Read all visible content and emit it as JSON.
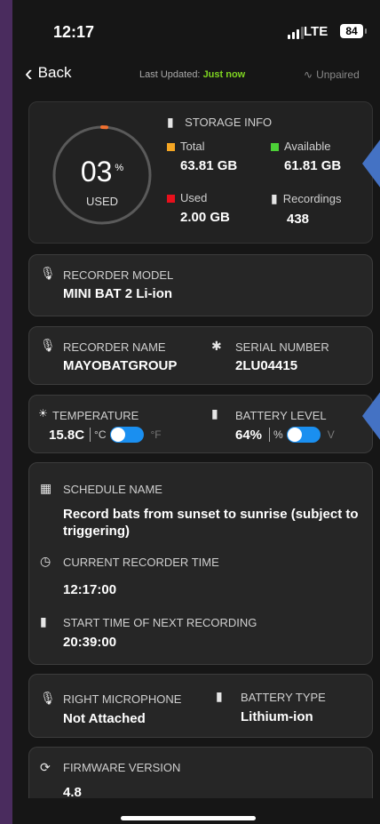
{
  "status_bar": {
    "time": "12:17",
    "network": "LTE",
    "battery": "84"
  },
  "nav": {
    "back_label": "Back",
    "last_updated_label": "Last Updated:",
    "last_updated_value": "Just now",
    "pair_status": "Unpaired"
  },
  "storage": {
    "title": "STORAGE INFO",
    "used_percent": "03",
    "percent_sign": "%",
    "used_caption": "USED",
    "used_fraction": 0.03,
    "total_label": "Total",
    "total_value": "63.81 GB",
    "available_label": "Available",
    "available_value": "61.81 GB",
    "used_label": "Used",
    "used_value": "2.00 GB",
    "recordings_label": "Recordings",
    "recordings_value": "438"
  },
  "recorder_model": {
    "label": "RECORDER MODEL",
    "value": "MINI BAT 2 Li-ion"
  },
  "recorder_name": {
    "label": "RECORDER NAME",
    "value": "MAYOBATGROUP"
  },
  "serial_number": {
    "label": "SERIAL NUMBER",
    "value": "2LU04415"
  },
  "temperature": {
    "label": "TEMPERATURE",
    "value": "15.8C",
    "unit_a": "°C",
    "unit_b": "°F"
  },
  "battery_level": {
    "label": "BATTERY LEVEL",
    "value": "64%",
    "unit_a": "%",
    "unit_b": "V"
  },
  "schedule": {
    "schedule_label": "SCHEDULE NAME",
    "schedule_value": "Record bats from sunset to sunrise (subject to triggering)",
    "time_label": "CURRENT RECORDER TIME",
    "time_value": "12:17:00",
    "next_label": "START TIME OF NEXT RECORDING",
    "next_value": "20:39:00"
  },
  "microphone": {
    "label": "RIGHT MICROPHONE",
    "value": "Not Attached"
  },
  "battery_type": {
    "label": "BATTERY TYPE",
    "value": "Lithium-ion"
  },
  "firmware": {
    "label": "FIRMWARE VERSION",
    "value": "4.8"
  },
  "colors": {
    "total": "#f5a623",
    "available": "#4cd137",
    "used": "#e8101c",
    "ring_accent": "#f07030",
    "toggle": "#1a8ff0",
    "callout": "#4472c4"
  }
}
